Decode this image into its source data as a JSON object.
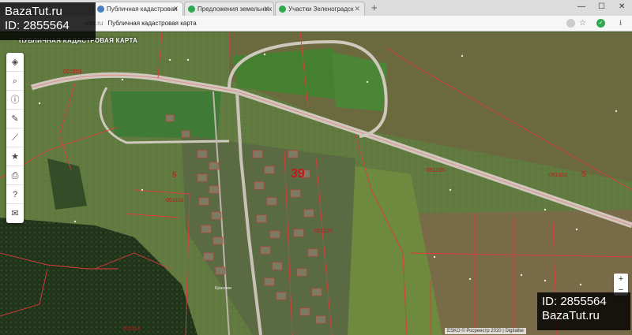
{
  "browser": {
    "tabs": [
      {
        "title": "Публичная кадастровая",
        "active": true
      },
      {
        "title": "Предложения земельных у",
        "active": false
      },
      {
        "title": "Участки Зеленоградск",
        "active": false
      }
    ],
    "new_tab": "+",
    "window_controls": [
      "—",
      "☐",
      "✕"
    ],
    "address": {
      "host": "estr.ru",
      "page_title": "Публичная кадастровая карта"
    }
  },
  "watermark": {
    "top_left": {
      "site": "BazaTut.ru",
      "id": "ID: 2855564"
    },
    "bottom_right": {
      "id": "ID: 2855564",
      "site": "BazaTut.ru"
    }
  },
  "map": {
    "title": "ПУБЛИЧНАЯ КАДАСТРОВАЯ КАРТА",
    "toolbar": [
      {
        "name": "layers-icon",
        "glyph": "◈"
      },
      {
        "name": "search-icon",
        "glyph": "⌕"
      },
      {
        "name": "info-icon",
        "glyph": "ⓘ"
      },
      {
        "name": "pencil-icon",
        "glyph": "✎"
      },
      {
        "name": "measure-icon",
        "glyph": "⟋"
      },
      {
        "name": "star-icon",
        "glyph": "★"
      },
      {
        "name": "print-icon",
        "glyph": "⎙"
      },
      {
        "name": "help-icon",
        "glyph": "?"
      },
      {
        "name": "mail-icon",
        "glyph": "✉"
      }
    ],
    "zoom": {
      "in": "+",
      "out": "−"
    },
    "attribution": "ESKO © Росреестр 2020 | Digitalbe",
    "zone_labels": [
      {
        "text": "39",
        "size": "large"
      },
      {
        "text": "5",
        "size": "medium"
      },
      {
        "text": "5",
        "size": "medium"
      },
      {
        "text": "Красное",
        "size": "small"
      }
    ],
    "quarter_labels": [
      "051105",
      "051101",
      "051102",
      "051102",
      "051114",
      "051003"
    ]
  }
}
